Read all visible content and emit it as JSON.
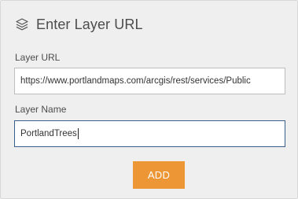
{
  "dialog": {
    "title": "Enter Layer URL",
    "header_icon": "layers-icon"
  },
  "layer_url": {
    "label": "Layer URL",
    "value": "https://www.portlandmaps.com/arcgis/rest/services/Public"
  },
  "layer_name": {
    "label": "Layer Name",
    "value": "PortlandTrees"
  },
  "actions": {
    "add_label": "ADD",
    "add_color": "#ec9636"
  }
}
